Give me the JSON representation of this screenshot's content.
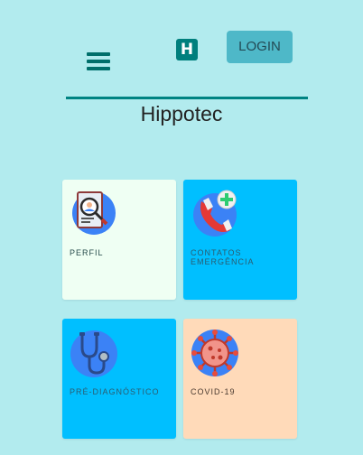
{
  "header": {
    "menu_icon": "hamburger-menu-icon",
    "logo_letter": "H",
    "login_label": "LOGIN"
  },
  "app_title": "Hippotec",
  "cards": [
    {
      "label": "PERFIL",
      "icon": "profile-document-search-icon",
      "color": "#effff3"
    },
    {
      "label": "CONTATOS EMERGÊNCIA",
      "icon": "phone-plus-icon",
      "color": "#00bfff"
    },
    {
      "label": "PRÉ-DIAGNÓSTICO",
      "icon": "stethoscope-icon",
      "color": "#00bfff"
    },
    {
      "label": "COVID-19",
      "icon": "virus-icon",
      "color": "#ffdab9"
    }
  ],
  "colors": {
    "background": "#b2ebee",
    "accent": "#008382",
    "login_button": "#4eb8c8",
    "icon_circle": "#3b82f6"
  }
}
